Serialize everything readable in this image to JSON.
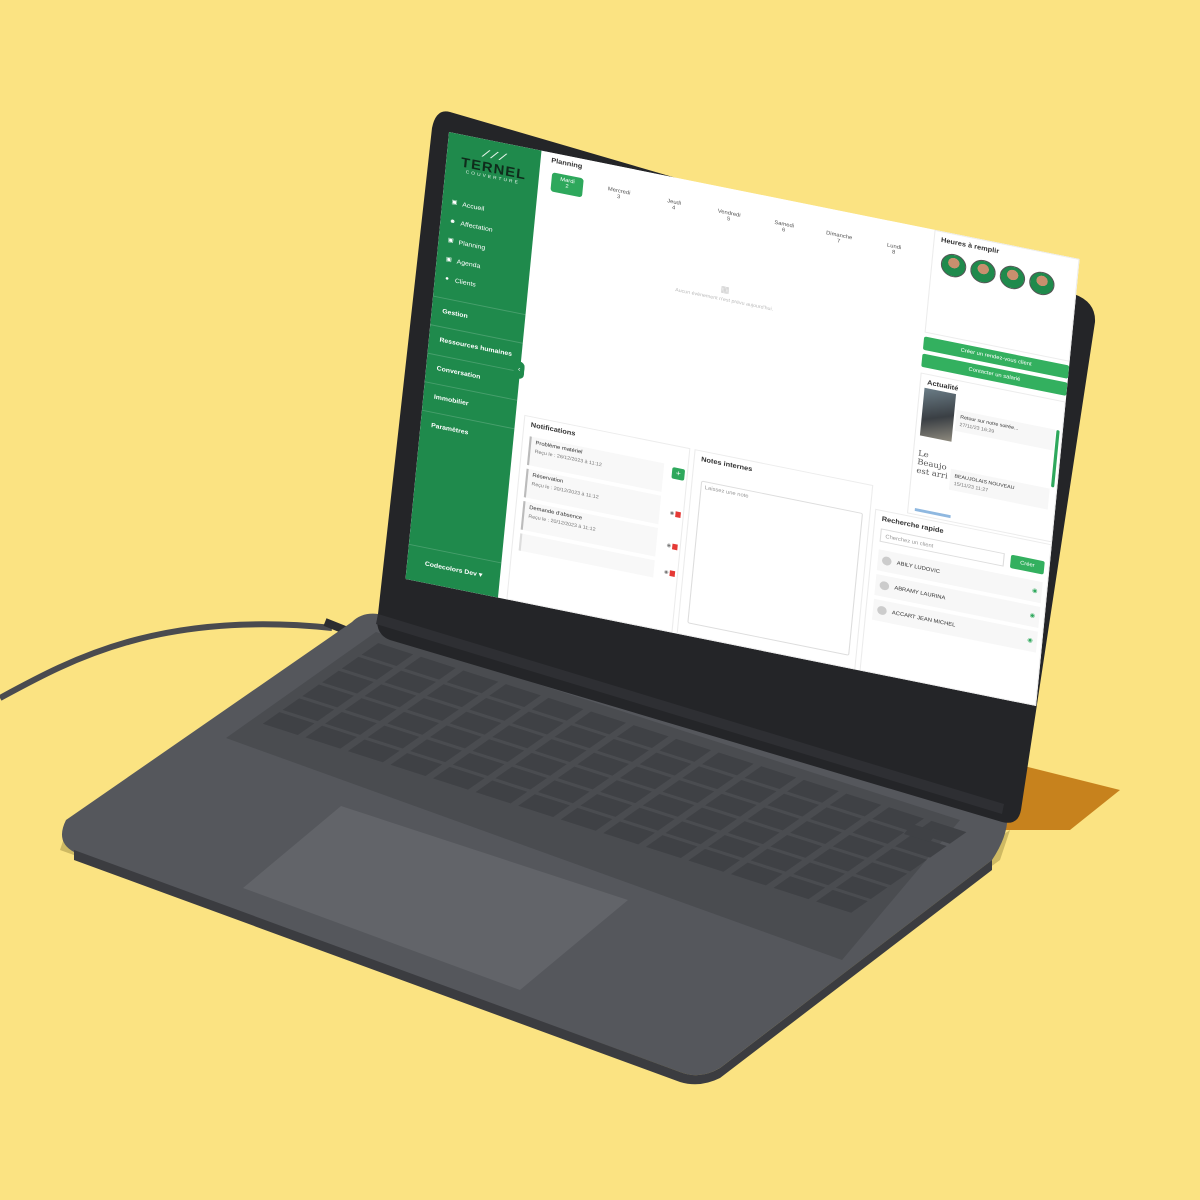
{
  "colors": {
    "background": "#fbe382",
    "sidebar": "#1f8a4c",
    "accent": "#33b05f",
    "laptop_body": "#55575c",
    "keys": "#3f4145"
  },
  "sidebar": {
    "logo": {
      "name": "TERNEL",
      "subtitle": "COUVERTURE"
    },
    "nav": [
      {
        "label": "Accueil",
        "icon": "calendar-icon"
      },
      {
        "label": "Affectation",
        "icon": "users-icon"
      },
      {
        "label": "Planning",
        "icon": "calendar-icon"
      },
      {
        "label": "Agenda",
        "icon": "calendar-icon"
      },
      {
        "label": "Clients",
        "icon": "user-icon"
      }
    ],
    "sections": [
      "Gestion",
      "Ressources humaines",
      "Conversation",
      "Immobilier",
      "Paramètres"
    ],
    "user": "Codecolors Dev"
  },
  "planning": {
    "title": "Planning",
    "days": [
      {
        "name": "Mardi",
        "num": "2"
      },
      {
        "name": "Mercredi",
        "num": "3"
      },
      {
        "name": "Jeudi",
        "num": "4"
      },
      {
        "name": "Vendredi",
        "num": "5"
      },
      {
        "name": "Samedi",
        "num": "6"
      },
      {
        "name": "Dimanche",
        "num": "7"
      },
      {
        "name": "Lundi",
        "num": "8"
      }
    ],
    "empty_text": "Aucun évènement n'est prévu aujourd'hui."
  },
  "heures": {
    "title": "Heures à remplir"
  },
  "actions": {
    "create_appointment": "Créer un rendez-vous client",
    "contact_employee": "Contacter un salarié"
  },
  "actualites": {
    "title": "Actualité",
    "items": [
      {
        "title": "Retour sur notre soirée...",
        "date": "27/11/23 16:29"
      },
      {
        "title": "BEAUJOLAIS NOUVEAU",
        "date": "15/11/23 11:27"
      }
    ],
    "image_text": "Le Beaujo est arri"
  },
  "notifications": {
    "title": "Notifications",
    "items": [
      {
        "title": "Problème matériel",
        "date": "Reçu le : 26/12/2023 à 11:12"
      },
      {
        "title": "Réservation",
        "date": "Reçu le : 20/12/2023 à 11:12"
      },
      {
        "title": "Demande d'absence",
        "date": "Reçu le : 20/12/2023 à 11:12"
      }
    ]
  },
  "notes": {
    "title": "Notes internes",
    "placeholder": "Laissez une note"
  },
  "recherche": {
    "title": "Recherche rapide",
    "placeholder": "Cherchez un client",
    "create_label": "Créer",
    "clients": [
      "ABILY LUDOVIC",
      "ABRAMY LAURINA",
      "ACCART JEAN MICHEL"
    ]
  }
}
